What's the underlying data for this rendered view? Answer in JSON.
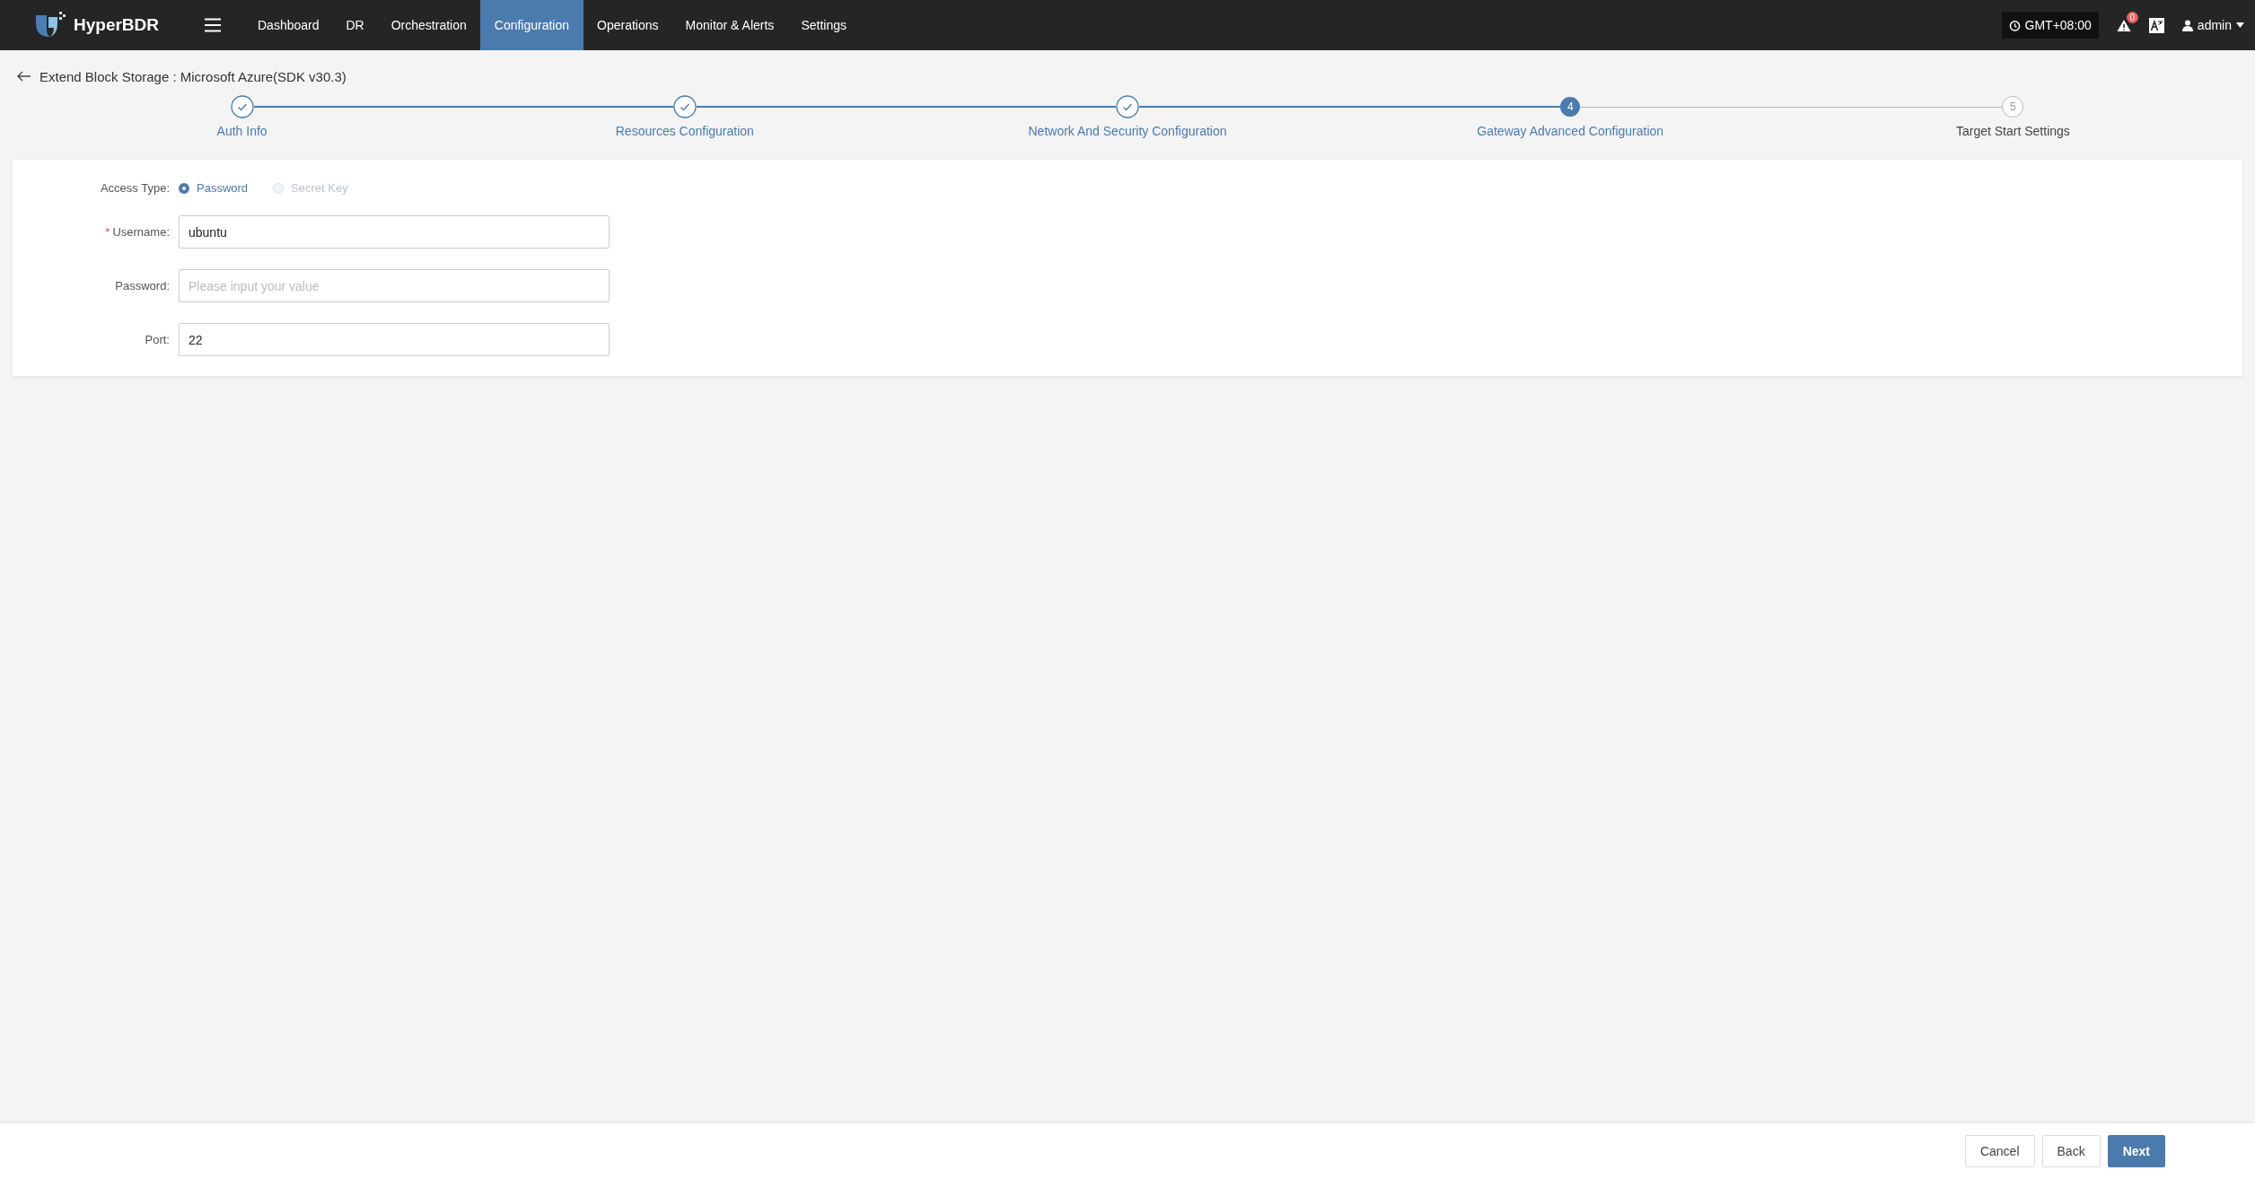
{
  "brand": "HyperBDR",
  "nav": [
    {
      "label": "Dashboard",
      "selected": false
    },
    {
      "label": "DR",
      "selected": false
    },
    {
      "label": "Orchestration",
      "selected": false
    },
    {
      "label": "Configuration",
      "selected": true
    },
    {
      "label": "Operations",
      "selected": false
    },
    {
      "label": "Monitor & Alerts",
      "selected": false
    },
    {
      "label": "Settings",
      "selected": false
    }
  ],
  "timezone": "GMT+08:00",
  "alert_count": "0",
  "user": "admin",
  "page_title": "Extend Block Storage : Microsoft Azure(SDK v30.3)",
  "steps": [
    {
      "label": "Auth Info",
      "done": true,
      "selected": false
    },
    {
      "label": "Resources Configuration",
      "done": true,
      "selected": false
    },
    {
      "label": "Network And Security Configuration",
      "done": true,
      "selected": false
    },
    {
      "label": "Gateway Advanced Configuration",
      "done": false,
      "selected": true,
      "number": "4"
    },
    {
      "label": "Target Start Settings",
      "done": false,
      "selected": false,
      "number": "5"
    }
  ],
  "access_type": {
    "label": "Access Type:",
    "options": [
      {
        "label": "Password",
        "selected": true,
        "disabled": false
      },
      {
        "label": "Secret Key",
        "selected": false,
        "disabled": true
      }
    ]
  },
  "fields": [
    {
      "label": "Username:",
      "required_mark": "*",
      "value": "ubuntu"
    },
    {
      "label": "Password:",
      "placeholder": "Please input your value"
    },
    {
      "label": "Port:",
      "value": "22"
    }
  ],
  "buttons": [
    {
      "label": "Cancel",
      "kind": "default"
    },
    {
      "label": "Back",
      "kind": "default"
    },
    {
      "label": "Next",
      "kind": "primary"
    }
  ]
}
